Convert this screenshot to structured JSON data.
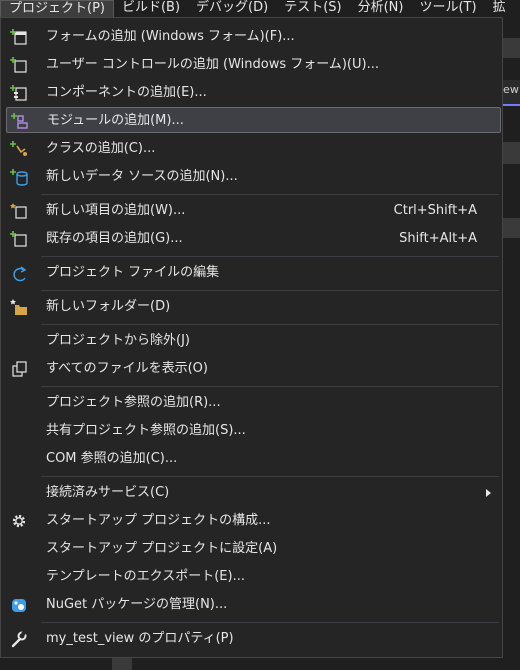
{
  "menubar": {
    "items": [
      {
        "label": "プロジェクト(P)"
      },
      {
        "label": "ビルド(B)"
      },
      {
        "label": "デバッグ(D)"
      },
      {
        "label": "テスト(S)"
      },
      {
        "label": "分析(N)"
      },
      {
        "label": "ツール(T)"
      },
      {
        "label": "拡"
      }
    ]
  },
  "background": {
    "tab_fragment": "iew"
  },
  "menu": {
    "items": [
      {
        "label": "フォームの追加 (Windows フォーム)(F)...",
        "icon": "add-form-icon"
      },
      {
        "label": "ユーザー コントロールの追加 (Windows フォーム)(U)...",
        "icon": "add-user-control-icon"
      },
      {
        "label": "コンポーネントの追加(E)...",
        "icon": "add-component-icon"
      },
      {
        "label": "モジュールの追加(M)...",
        "icon": "add-module-icon",
        "highlighted": true
      },
      {
        "label": "クラスの追加(C)...",
        "icon": "add-class-icon"
      },
      {
        "label": "新しいデータ ソースの追加(N)...",
        "icon": "add-data-source-icon"
      },
      {
        "label": "新しい項目の追加(W)...",
        "shortcut": "Ctrl+Shift+A",
        "icon": "new-item-icon"
      },
      {
        "label": "既存の項目の追加(G)...",
        "shortcut": "Shift+Alt+A",
        "icon": "existing-item-icon"
      },
      {
        "label": "プロジェクト ファイルの編集",
        "icon": "edit-project-file-icon"
      },
      {
        "label": "新しいフォルダー(D)",
        "icon": "new-folder-icon"
      },
      {
        "label": "プロジェクトから除外(J)",
        "icon": ""
      },
      {
        "label": "すべてのファイルを表示(O)",
        "icon": "show-all-files-icon"
      },
      {
        "label": "プロジェクト参照の追加(R)...",
        "icon": ""
      },
      {
        "label": "共有プロジェクト参照の追加(S)...",
        "icon": ""
      },
      {
        "label": "COM 参照の追加(C)...",
        "icon": ""
      },
      {
        "label": "接続済みサービス(C)",
        "icon": "",
        "submenu": true
      },
      {
        "label": "スタートアップ プロジェクトの構成...",
        "icon": "gear-icon"
      },
      {
        "label": "スタートアップ プロジェクトに設定(A)",
        "icon": ""
      },
      {
        "label": "テンプレートのエクスポート(E)...",
        "icon": ""
      },
      {
        "label": "NuGet パッケージの管理(N)...",
        "icon": "nuget-icon"
      },
      {
        "label": "my_test_view のプロパティ(P)",
        "icon": "wrench-icon"
      }
    ]
  },
  "colors": {
    "menu_bg": "#252526",
    "highlight_bg": "#3f3f46",
    "icon_green": "#6cc04a",
    "icon_blue": "#3c9ee8",
    "icon_purple": "#b38ee0",
    "icon_orange": "#d8a640"
  }
}
